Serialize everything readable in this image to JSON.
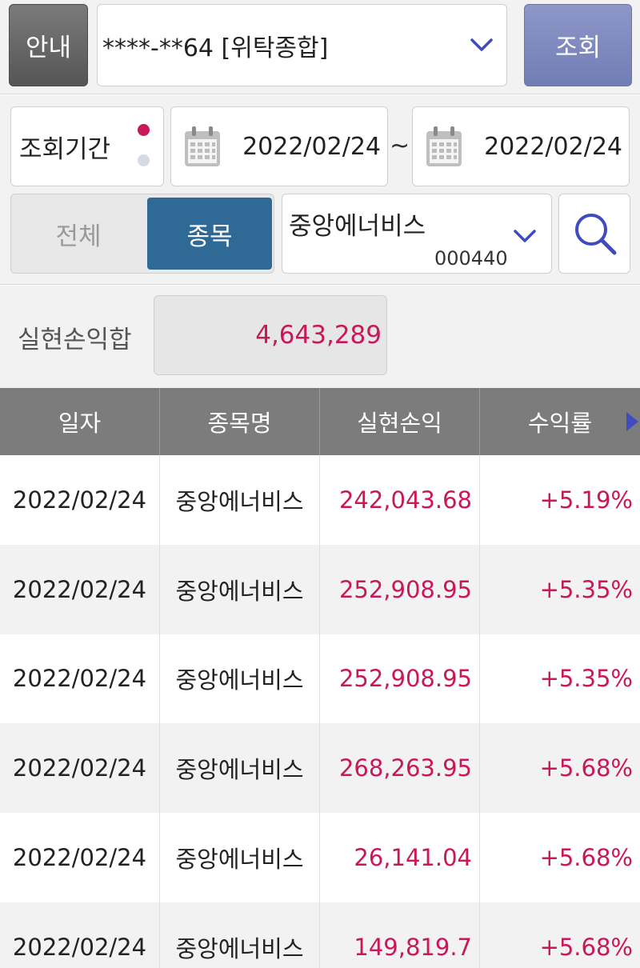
{
  "top_bar": {
    "guide_label": "안내",
    "account_value": "****-**64 [위탁종합]",
    "query_label": "조회"
  },
  "filter": {
    "period_label": "조회기간",
    "date_from": "2022/02/24",
    "date_separator": "~",
    "date_to": "2022/02/24",
    "segment": {
      "all_label": "전체",
      "item_label": "종목",
      "selected": "종목"
    },
    "stock_name": "중앙에너비스",
    "stock_code": "000440"
  },
  "summary": {
    "label": "실현손익합",
    "value": "4,643,289"
  },
  "table": {
    "headers": [
      "일자",
      "종목명",
      "실현손익",
      "수익률"
    ],
    "rows": [
      {
        "date": "2022/02/24",
        "name": "중앙에너비스",
        "pl": "242,043.68",
        "rate": "+5.19%"
      },
      {
        "date": "2022/02/24",
        "name": "중앙에너비스",
        "pl": "252,908.95",
        "rate": "+5.35%"
      },
      {
        "date": "2022/02/24",
        "name": "중앙에너비스",
        "pl": "252,908.95",
        "rate": "+5.35%"
      },
      {
        "date": "2022/02/24",
        "name": "중앙에너비스",
        "pl": "268,263.95",
        "rate": "+5.68%"
      },
      {
        "date": "2022/02/24",
        "name": "중앙에너비스",
        "pl": "26,141.04",
        "rate": "+5.68%"
      },
      {
        "date": "2022/02/24",
        "name": "중앙에너비스",
        "pl": "149,819.7",
        "rate": "+5.68%"
      }
    ]
  },
  "colors": {
    "accent_red": "#c8185a",
    "segment_active": "#2f6a96",
    "query_button": "#7e88be",
    "header_bg": "#7c7c7c",
    "arrow_blue": "#3f4bbf"
  }
}
